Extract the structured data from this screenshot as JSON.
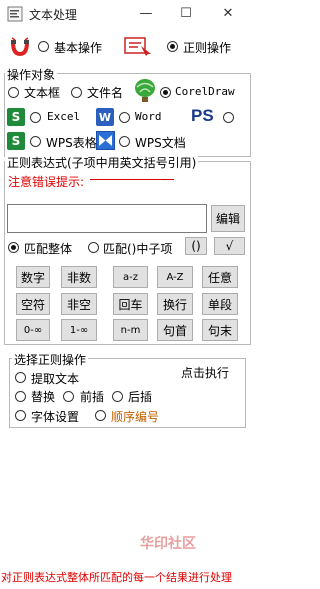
{
  "window": {
    "title": "文本处理",
    "minimize": "—",
    "maximize": "☐",
    "close": "✕"
  },
  "modes": {
    "basic_label": "基本操作",
    "regex_label": "正则操作",
    "selected": "regex"
  },
  "targets": {
    "group_title": "操作对象",
    "textbox_label": "文本框",
    "filename_label": "文件名",
    "coreldraw_label": "CorelDraw",
    "excel_label": "Excel",
    "word_label": "Word",
    "ps_icon_text": "PS",
    "wps_sheet_label": "WPS表格",
    "wps_doc_label": "WPS文档",
    "word_icon_text": "W",
    "excel_icon_text": "S",
    "selected": "coreldraw"
  },
  "regex": {
    "group_title": "正则表达式(子项中用英文括号引用)",
    "error_hint": "注意错误提示:",
    "edit_button": "编辑",
    "match_whole_label": "匹配整体",
    "match_sub_label": "匹配()中子项",
    "paren_button": "()",
    "check_button": "√",
    "match_selected": "whole",
    "input_value": ""
  },
  "quick_buttons": {
    "row1": [
      "数字",
      "非数",
      "a-z",
      "A-Z",
      "任意"
    ],
    "row2": [
      "空符",
      "非空",
      "回车",
      "换行",
      "单段"
    ],
    "row3": [
      "0-∞",
      "1-∞",
      "n-m",
      "句首",
      "句末"
    ]
  },
  "operations": {
    "group_title": "选择正则操作",
    "extract_label": "提取文本",
    "run_label": "点击执行",
    "replace_label": "替换",
    "prefix_label": "前插",
    "suffix_label": "后插",
    "font_label": "字体设置",
    "sequence_label": "顺序编号"
  },
  "status_text": "对正则表达式整体所匹配的每一个结果进行处理",
  "watermark": "华印社区",
  "colors": {
    "error_red": "#e00000",
    "sequence_orange": "#c06000",
    "word_blue": "#2b5fbf",
    "excel_green": "#1f8a3a",
    "ps_blue": "#1a3a8a"
  }
}
